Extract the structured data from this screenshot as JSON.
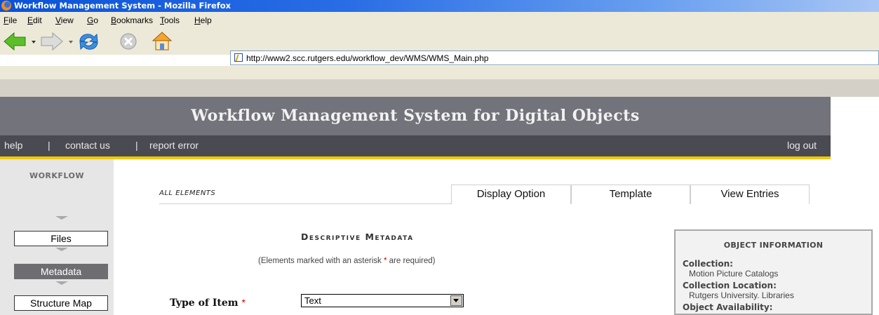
{
  "window": {
    "title": "Workflow Management System - Mozilla Firefox"
  },
  "menu": [
    "File",
    "Edit",
    "View",
    "Go",
    "Bookmarks",
    "Tools",
    "Help"
  ],
  "menu_mnemonics": [
    "F",
    "E",
    "V",
    "G",
    "B",
    "T",
    "H"
  ],
  "address": {
    "url": "http://www2.scc.rutgers.edu/workflow_dev/WMS/WMS_Main.php"
  },
  "header": {
    "title": "Workflow Management System for Digital Objects",
    "links": {
      "help": "help",
      "contact": "contact us",
      "report": "report error",
      "sep": "|",
      "logout": "log out"
    }
  },
  "sidebar": {
    "label": "WORKFLOW",
    "items": [
      {
        "label": "Files",
        "active": false
      },
      {
        "label": "Metadata",
        "active": true
      },
      {
        "label": "Structure Map",
        "active": false
      }
    ]
  },
  "tabs": {
    "section": "ALL ELEMENTS",
    "options": [
      "Display Option",
      "Template",
      "View Entries"
    ]
  },
  "form": {
    "title": "Descriptive Metadata",
    "note_before": "(Elements marked with an asterisk ",
    "asterisk": "*",
    "note_after": " are required)",
    "type_label": "Type of Item",
    "type_value": "Text"
  },
  "object_info": {
    "heading": "OBJECT INFORMATION",
    "fields": [
      {
        "key": "Collection:",
        "value": "Motion Picture Catalogs"
      },
      {
        "key": "Collection Location:",
        "value": "Rutgers University. Libraries"
      },
      {
        "key": "Object Availability:",
        "value": ""
      }
    ]
  },
  "colors": {
    "titlebar": "#0a52d6",
    "header_bg": "#73737b",
    "linkbar_bg": "#4a4a52",
    "accent_line": "#f0c800",
    "sidebar_bg": "#e6e6e6",
    "active_item": "#6e6e72",
    "required": "#cc0000"
  }
}
